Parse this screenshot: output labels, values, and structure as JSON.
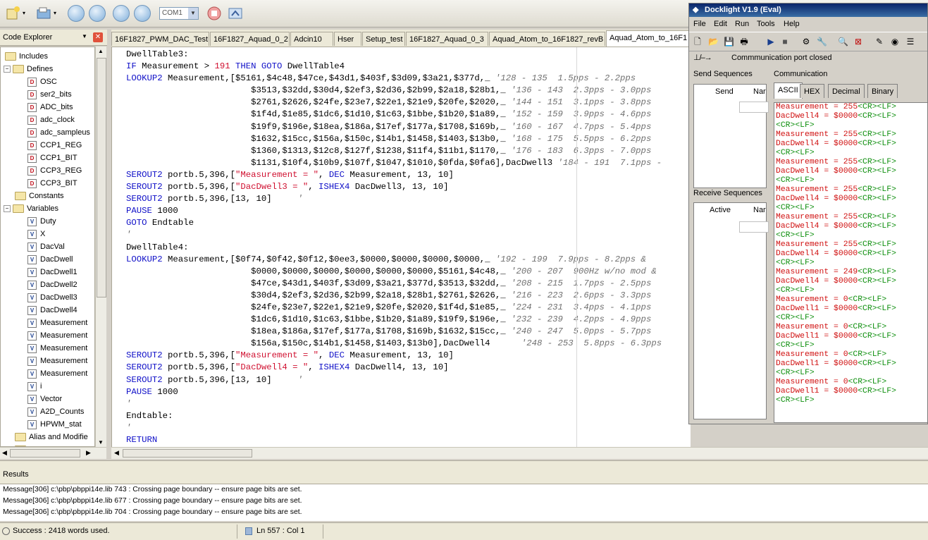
{
  "toolbar": {
    "com_port": "COM1"
  },
  "explorer": {
    "title": "Code Explorer",
    "nodes": [
      {
        "label": "Includes"
      },
      {
        "label": "Defines"
      },
      {
        "label": "OSC"
      },
      {
        "label": "ser2_bits"
      },
      {
        "label": "ADC_bits"
      },
      {
        "label": "adc_clock"
      },
      {
        "label": "adc_sampleus"
      },
      {
        "label": "CCP1_REG"
      },
      {
        "label": "CCP1_BIT"
      },
      {
        "label": "CCP3_REG"
      },
      {
        "label": "CCP3_BIT"
      },
      {
        "label": "Constants"
      },
      {
        "label": "Variables"
      },
      {
        "label": "Duty"
      },
      {
        "label": "X"
      },
      {
        "label": "DacVal"
      },
      {
        "label": "DacDwell"
      },
      {
        "label": "DacDwell1"
      },
      {
        "label": "DacDwell2"
      },
      {
        "label": "DacDwell3"
      },
      {
        "label": "DacDwell4"
      },
      {
        "label": "Measurement"
      },
      {
        "label": "Measurement"
      },
      {
        "label": "Measurement"
      },
      {
        "label": "Measurement"
      },
      {
        "label": "Measurement"
      },
      {
        "label": "i"
      },
      {
        "label": "Vector"
      },
      {
        "label": "A2D_Counts"
      },
      {
        "label": "HPWM_stat"
      },
      {
        "label": "Alias and Modifie"
      },
      {
        "label": "Symbols"
      }
    ]
  },
  "tabs": [
    {
      "label": "16F1827_PWM_DAC_Test"
    },
    {
      "label": "16F1827_Aquad_0_2"
    },
    {
      "label": "Adcin10"
    },
    {
      "label": "Hser"
    },
    {
      "label": "Setup_test"
    },
    {
      "label": "16F1827_Aquad_0_3"
    },
    {
      "label": "Aquad_Atom_to_16F1827_revB"
    },
    {
      "label": "Aquad_Atom_to_16F1"
    }
  ],
  "code": [
    [
      {
        "t": "DwellTable3:",
        "c": ""
      }
    ],
    [
      {
        "t": "IF",
        "c": "kw"
      },
      {
        "t": " Measurement > ",
        "c": ""
      },
      {
        "t": "191",
        "c": "num"
      },
      {
        "t": " ",
        "c": ""
      },
      {
        "t": "THEN GOTO",
        "c": "kw"
      },
      {
        "t": " DwellTable4",
        "c": ""
      }
    ],
    [
      {
        "t": "LOOKUP2",
        "c": "kw"
      },
      {
        "t": " Measurement,[$5161,$4c48,$47ce,$43d1,$403f,$3d09,$3a21,$377d,_ ",
        "c": ""
      },
      {
        "t": "'128 - 135  1.5pps - 2.2pps",
        "c": "cm"
      }
    ],
    [
      {
        "t": "                        $3513,$32dd,$30d4,$2ef3,$2d36,$2b99,$2a18,$28b1,_ ",
        "c": ""
      },
      {
        "t": "'136 - 143  2.3pps - 3.0pps",
        "c": "cm"
      }
    ],
    [
      {
        "t": "                        $2761,$2626,$24fe,$23e7,$22e1,$21e9,$20fe,$2020,_ ",
        "c": ""
      },
      {
        "t": "'144 - 151  3.1pps - 3.8pps",
        "c": "cm"
      }
    ],
    [
      {
        "t": "                        $1f4d,$1e85,$1dc6,$1d10,$1c63,$1bbe,$1b20,$1a89,_ ",
        "c": ""
      },
      {
        "t": "'152 - 159  3.9pps - 4.6pps",
        "c": "cm"
      }
    ],
    [
      {
        "t": "                        $19f9,$196e,$18ea,$186a,$17ef,$177a,$1708,$169b,_ ",
        "c": ""
      },
      {
        "t": "'160 - 167  4.7pps - 5.4pps",
        "c": "cm"
      }
    ],
    [
      {
        "t": "                        $1632,$15cc,$156a,$150c,$14b1,$1458,$1403,$13b0,_ ",
        "c": ""
      },
      {
        "t": "'168 - 175  5.5pps - 6.2pps",
        "c": "cm"
      }
    ],
    [
      {
        "t": "                        $1360,$1313,$12c8,$127f,$1238,$11f4,$11b1,$1170,_ ",
        "c": ""
      },
      {
        "t": "'176 - 183  6.3pps - 7.0pps",
        "c": "cm"
      }
    ],
    [
      {
        "t": "                        $1131,$10f4,$10b9,$107f,$1047,$1010,$0fda,$0fa6],DacDwell3 ",
        "c": ""
      },
      {
        "t": "'184 - 191  7.1pps -",
        "c": "cm"
      }
    ],
    [
      {
        "t": "SEROUT2",
        "c": "kw"
      },
      {
        "t": " portb.5,396,[",
        "c": ""
      },
      {
        "t": "\"Measurement = \"",
        "c": "str"
      },
      {
        "t": ", ",
        "c": ""
      },
      {
        "t": "DEC",
        "c": "kw"
      },
      {
        "t": " Measurement, 13, 10]",
        "c": ""
      }
    ],
    [
      {
        "t": "SEROUT2",
        "c": "kw"
      },
      {
        "t": " portb.5,396,[",
        "c": ""
      },
      {
        "t": "\"DacDwell3 = \"",
        "c": "str"
      },
      {
        "t": ", ",
        "c": ""
      },
      {
        "t": "ISHEX4",
        "c": "kw"
      },
      {
        "t": " DacDwell3, 13, 10]",
        "c": ""
      }
    ],
    [
      {
        "t": "SEROUT2",
        "c": "kw"
      },
      {
        "t": " portb.5,396,[13, 10]     ",
        "c": ""
      },
      {
        "t": "'",
        "c": "cm"
      }
    ],
    [
      {
        "t": "PAUSE",
        "c": "kw"
      },
      {
        "t": " 1000",
        "c": ""
      }
    ],
    [
      {
        "t": "GOTO",
        "c": "kw"
      },
      {
        "t": " Endtable",
        "c": ""
      }
    ],
    [
      {
        "t": "'",
        "c": "cm"
      }
    ],
    [
      {
        "t": "DwellTable4:",
        "c": ""
      }
    ],
    [
      {
        "t": "LOOKUP2",
        "c": "kw"
      },
      {
        "t": " Measurement,[$0f74,$0f42,$0f12,$0ee3,$0000,$0000,$0000,$0000,_ ",
        "c": ""
      },
      {
        "t": "'192 - 199  7.9pps - 8.2pps &",
        "c": "cm"
      }
    ],
    [
      {
        "t": "                        $0000,$0000,$0000,$0000,$0000,$0000,$5161,$4c48,_ ",
        "c": ""
      },
      {
        "t": "'200 - 207  900Hz w/no mod &",
        "c": "cm"
      }
    ],
    [
      {
        "t": "                        $47ce,$43d1,$403f,$3d09,$3a21,$377d,$3513,$32dd,_ ",
        "c": ""
      },
      {
        "t": "'208 - 215  1.7pps - 2.5pps",
        "c": "cm"
      }
    ],
    [
      {
        "t": "                        $30d4,$2ef3,$2d36,$2b99,$2a18,$28b1,$2761,$2626,_ ",
        "c": ""
      },
      {
        "t": "'216 - 223  2.6pps - 3.3pps",
        "c": "cm"
      }
    ],
    [
      {
        "t": "                        $24fe,$23e7,$22e1,$21e9,$20fe,$2020,$1f4d,$1e85,_ ",
        "c": ""
      },
      {
        "t": "'224 - 231  3.4pps - 4.1pps",
        "c": "cm"
      }
    ],
    [
      {
        "t": "                        $1dc6,$1d10,$1c63,$1bbe,$1b20,$1a89,$19f9,$196e,_ ",
        "c": ""
      },
      {
        "t": "'232 - 239  4.2pps - 4.9pps",
        "c": "cm"
      }
    ],
    [
      {
        "t": "                        $18ea,$186a,$17ef,$177a,$1708,$169b,$1632,$15cc,_ ",
        "c": ""
      },
      {
        "t": "'240 - 247  5.0pps - 5.7pps",
        "c": "cm"
      }
    ],
    [
      {
        "t": "                        $156a,$150c,$14b1,$1458,$1403,$13b0],DacDwell4      ",
        "c": ""
      },
      {
        "t": "'248 - 253  5.8pps - 6.3pps",
        "c": "cm"
      }
    ],
    [
      {
        "t": "SEROUT2",
        "c": "kw"
      },
      {
        "t": " portb.5,396,[",
        "c": ""
      },
      {
        "t": "\"Measurement = \"",
        "c": "str"
      },
      {
        "t": ", ",
        "c": ""
      },
      {
        "t": "DEC",
        "c": "kw"
      },
      {
        "t": " Measurement, 13, 10]",
        "c": ""
      }
    ],
    [
      {
        "t": "SEROUT2",
        "c": "kw"
      },
      {
        "t": " portb.5,396,[",
        "c": ""
      },
      {
        "t": "\"DacDwell4 = \"",
        "c": "str"
      },
      {
        "t": ", ",
        "c": ""
      },
      {
        "t": "ISHEX4",
        "c": "kw"
      },
      {
        "t": " DacDwell4, 13, 10]",
        "c": ""
      }
    ],
    [
      {
        "t": "SEROUT2",
        "c": "kw"
      },
      {
        "t": " portb.5,396,[13, 10]     ",
        "c": ""
      },
      {
        "t": "'",
        "c": "cm"
      }
    ],
    [
      {
        "t": "PAUSE",
        "c": "kw"
      },
      {
        "t": " 1000",
        "c": ""
      }
    ],
    [
      {
        "t": "'",
        "c": "cm"
      }
    ],
    [
      {
        "t": "Endtable:",
        "c": ""
      }
    ],
    [
      {
        "t": "'",
        "c": "cm"
      }
    ],
    [
      {
        "t": "RETURN",
        "c": "kw"
      }
    ],
    [
      {
        "t": "'",
        "c": "cm"
      }
    ]
  ],
  "results": {
    "title": "Results",
    "messages": [
      "Message[306] c:\\pbp\\pbppi14e.lib 743 : Crossing page boundary -- ensure page bits are set.",
      "Message[306] c:\\pbp\\pbppi14e.lib 677 : Crossing page boundary -- ensure page bits are set.",
      "Message[306] c:\\pbp\\pbppi14e.lib 704 : Crossing page boundary -- ensure page bits are set."
    ]
  },
  "status": {
    "success": "Success : 2418 words used.",
    "position": "Ln 557 : Col 1"
  },
  "docklight": {
    "title": "Docklight V1.9 (Eval)",
    "menu": [
      "File",
      "Edit",
      "Run",
      "Tools",
      "Help"
    ],
    "port_status": "Commmunication port closed",
    "send_sequences": "Send Sequences",
    "send_col": "Send",
    "name_col": "Nar",
    "receive_sequences": "Receive Sequences",
    "active_col": "Active",
    "name_col2": "Nar",
    "communication": "Communication",
    "comm_tabs": [
      "ASCII",
      "HEX",
      "Decimal",
      "Binary"
    ],
    "log": [
      {
        "t": "Measurement = 255",
        "c": "r"
      },
      {
        "t": "<CR><LF>",
        "c": "g"
      },
      {
        "t": "\n",
        "c": ""
      },
      {
        "t": "DacDwell4 = $0000",
        "c": "r"
      },
      {
        "t": "<CR><LF>\n<CR><LF>",
        "c": "g"
      },
      {
        "t": "\n",
        "c": ""
      },
      {
        "t": "Measurement = 255",
        "c": "r"
      },
      {
        "t": "<CR><LF>",
        "c": "g"
      },
      {
        "t": "\n",
        "c": ""
      },
      {
        "t": "DacDwell4 = $0000",
        "c": "r"
      },
      {
        "t": "<CR><LF>\n<CR><LF>",
        "c": "g"
      },
      {
        "t": "\n",
        "c": ""
      },
      {
        "t": "Measurement = 255",
        "c": "r"
      },
      {
        "t": "<CR><LF>",
        "c": "g"
      },
      {
        "t": "\n",
        "c": ""
      },
      {
        "t": "DacDwell4 = $0000",
        "c": "r"
      },
      {
        "t": "<CR><LF>\n<CR><LF>",
        "c": "g"
      },
      {
        "t": "\n",
        "c": ""
      },
      {
        "t": "Measurement = 255",
        "c": "r"
      },
      {
        "t": "<CR><LF>",
        "c": "g"
      },
      {
        "t": "\n",
        "c": ""
      },
      {
        "t": "DacDwell4 = $0000",
        "c": "r"
      },
      {
        "t": "<CR><LF>\n<CR><LF>",
        "c": "g"
      },
      {
        "t": "\n",
        "c": ""
      },
      {
        "t": "Measurement = 255",
        "c": "r"
      },
      {
        "t": "<CR><LF>",
        "c": "g"
      },
      {
        "t": "\n",
        "c": ""
      },
      {
        "t": "DacDwell4 = $0000",
        "c": "r"
      },
      {
        "t": "<CR><LF>\n<CR><LF>",
        "c": "g"
      },
      {
        "t": "\n",
        "c": ""
      },
      {
        "t": "Measurement = 255",
        "c": "r"
      },
      {
        "t": "<CR><LF>",
        "c": "g"
      },
      {
        "t": "\n",
        "c": ""
      },
      {
        "t": "DacDwell4 = $0000",
        "c": "r"
      },
      {
        "t": "<CR><LF>\n<CR><LF>",
        "c": "g"
      },
      {
        "t": "\n",
        "c": ""
      },
      {
        "t": "Measurement = 249",
        "c": "r"
      },
      {
        "t": "<CR><LF>",
        "c": "g"
      },
      {
        "t": "\n",
        "c": ""
      },
      {
        "t": "DacDwell4 = $0000",
        "c": "r"
      },
      {
        "t": "<CR><LF>\n<CR><LF>",
        "c": "g"
      },
      {
        "t": "\n",
        "c": ""
      },
      {
        "t": "Measurement = 0",
        "c": "r"
      },
      {
        "t": "<CR><LF>",
        "c": "g"
      },
      {
        "t": "\n",
        "c": ""
      },
      {
        "t": "DacDwell1 = $0000",
        "c": "r"
      },
      {
        "t": "<CR><LF>\n<CR><LF>",
        "c": "g"
      },
      {
        "t": "\n",
        "c": ""
      },
      {
        "t": "Measurement = 0",
        "c": "r"
      },
      {
        "t": "<CR><LF>",
        "c": "g"
      },
      {
        "t": "\n",
        "c": ""
      },
      {
        "t": "DacDwell1 = $0000",
        "c": "r"
      },
      {
        "t": "<CR><LF>\n<CR><LF>",
        "c": "g"
      },
      {
        "t": "\n",
        "c": ""
      },
      {
        "t": "Measurement = 0",
        "c": "r"
      },
      {
        "t": "<CR><LF>",
        "c": "g"
      },
      {
        "t": "\n",
        "c": ""
      },
      {
        "t": "DacDwell1 = $0000",
        "c": "r"
      },
      {
        "t": "<CR><LF>\n<CR><LF>",
        "c": "g"
      },
      {
        "t": "\n",
        "c": ""
      },
      {
        "t": "Measurement = 0",
        "c": "r"
      },
      {
        "t": "<CR><LF>",
        "c": "g"
      },
      {
        "t": "\n",
        "c": ""
      },
      {
        "t": "DacDwell1 = $0000",
        "c": "r"
      },
      {
        "t": "<CR><LF>\n<CR><LF>",
        "c": "g"
      }
    ]
  }
}
